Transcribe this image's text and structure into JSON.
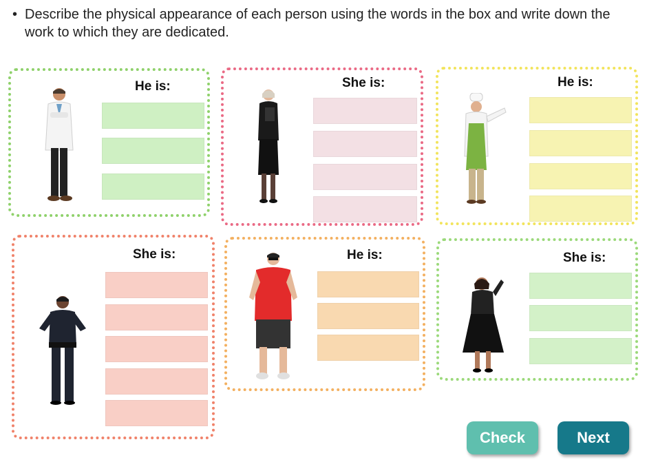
{
  "instruction": {
    "bullet": "•",
    "text": "Describe the physical appearance of each person using the words in the box and write down the work to which they are dedicated."
  },
  "cards": [
    {
      "title": "He is:",
      "border_color": "#8fd16b",
      "box_color": "#cff0c3",
      "person": "doctor"
    },
    {
      "title": "She is:",
      "border_color": "#ea6a85",
      "box_color": "#f3e0e4",
      "person": "businesswoman"
    },
    {
      "title": "He is:",
      "border_color": "#f2e45c",
      "box_color": "#f7f3b2",
      "person": "chef"
    },
    {
      "title": "She is:",
      "border_color": "#f0826a",
      "box_color": "#f9cfc6",
      "person": "police-officer"
    },
    {
      "title": "He is:",
      "border_color": "#f3b060",
      "box_color": "#f9d9b0",
      "person": "man-in-red-shirt"
    },
    {
      "title": "She is:",
      "border_color": "#9bd97a",
      "box_color": "#d3f1c8",
      "person": "woman-in-black-dress"
    }
  ],
  "buttons": {
    "check": {
      "label": "Check",
      "color": "#5fbfae"
    },
    "next": {
      "label": "Next",
      "color": "#16798a"
    }
  }
}
